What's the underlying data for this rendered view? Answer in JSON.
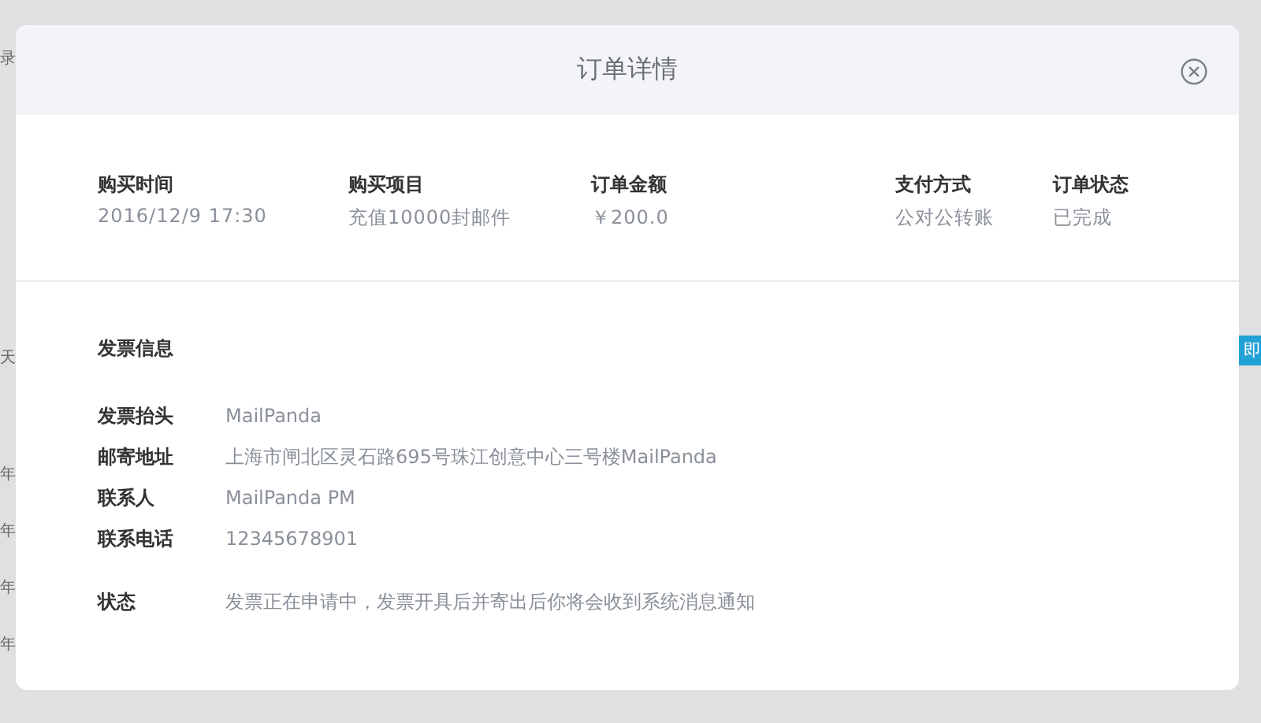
{
  "background": {
    "left_fragments": [
      "录",
      "天",
      "年",
      "年",
      "年",
      "年"
    ],
    "right_button": "即"
  },
  "dialog": {
    "title": "订单详情",
    "summary": [
      {
        "label": "购买时间",
        "value": "2016/12/9 17:30"
      },
      {
        "label": "购买项目",
        "value": "充值10000封邮件"
      },
      {
        "label": "订单金额",
        "value": "￥200.0"
      },
      {
        "label": "支付方式",
        "value": "公对公转账"
      },
      {
        "label": "订单状态",
        "value": "已完成"
      }
    ],
    "invoice": {
      "heading": "发票信息",
      "rows": [
        {
          "label": "发票抬头",
          "value": "MailPanda"
        },
        {
          "label": "邮寄地址",
          "value": "上海市闸北区灵石路695号珠江创意中心三号楼MailPanda"
        },
        {
          "label": "联系人",
          "value": "MailPanda PM"
        },
        {
          "label": "联系电话",
          "value": "12345678901"
        }
      ],
      "status": {
        "label": "状态",
        "value": "发票正在申请中，发票开具后并寄出后你将会收到系统消息通知"
      }
    }
  }
}
